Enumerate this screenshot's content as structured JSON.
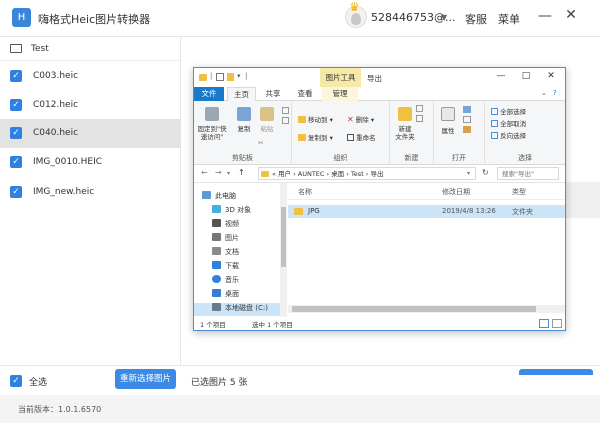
{
  "app": {
    "title": "嗨格式Heic图片转换器",
    "logo": "H",
    "account": "528446753@...",
    "service": "客服",
    "menu": "菜单",
    "minimize": "—",
    "close": "✕"
  },
  "sidebar": {
    "folder": "Test",
    "files": [
      {
        "name": "C003.heic",
        "checked": true
      },
      {
        "name": "C012.heic",
        "checked": true
      },
      {
        "name": "C040.heic",
        "checked": true,
        "selected": true
      },
      {
        "name": "IMG_0010.HEIC",
        "checked": true
      },
      {
        "name": "IMG_new.heic",
        "checked": true
      }
    ]
  },
  "bottom": {
    "select_all": "全选",
    "reselect_button": "重新选择图片",
    "selected_count": "已选图片 5 张"
  },
  "footer": {
    "version": "当前版本：1.0.1.6570"
  },
  "explorer": {
    "context_tab": "图片工具",
    "window_title": "导出",
    "tabs": {
      "file": "文件",
      "home": "主页",
      "share": "共享",
      "view": "查看",
      "manage": "管理"
    },
    "ribbon": {
      "pin": "固定到\"快\n速访问\"",
      "copy": "复制",
      "paste": "粘贴",
      "clipboard_group": "剪贴板",
      "move_to": "移动到",
      "copy_to": "复制到",
      "delete": "删除",
      "rename": "重命名",
      "organize_group": "组织",
      "new_folder": "新建\n文件夹",
      "new_group": "新建",
      "properties": "属性",
      "open_group": "打开",
      "select_all": "全部选择",
      "select_none": "全部取消",
      "invert": "反向选择",
      "select_group": "选择"
    },
    "address": "« 用户 › AUNTEC › 桌面 › Test › 导出",
    "search_placeholder": "搜索\"导出\"",
    "nav": [
      "此电脑",
      "3D 对象",
      "视频",
      "图片",
      "文档",
      "下载",
      "音乐",
      "桌面",
      "本地磁盘 (C:)"
    ],
    "columns": {
      "name": "名称",
      "date": "修改日期",
      "type": "类型"
    },
    "rows": [
      {
        "name": "JPG",
        "date": "2019/4/8 13:26",
        "type": "文件夹"
      }
    ],
    "status_count": "1 个项目",
    "status_selected": "选中 1 个项目"
  },
  "colors": {
    "accent": "#3b8ae6",
    "checkbox": "#2f80e0",
    "selected_row": "#cce4f7",
    "file_tab": "#1979ca",
    "context_tab": "#f6e8a6"
  }
}
